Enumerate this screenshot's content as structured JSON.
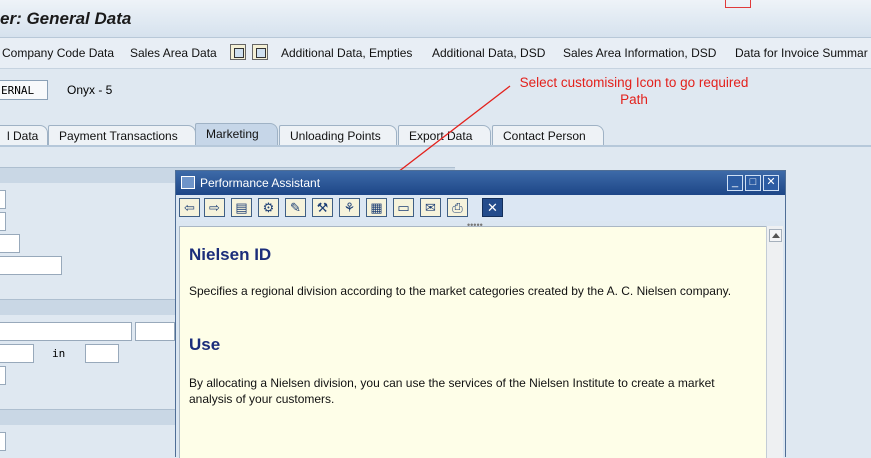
{
  "window": {
    "title": "er: General Data"
  },
  "toolbar": {
    "company_code": "Company Code Data",
    "sales_area": "Sales Area Data",
    "icon1": "document-icon",
    "icon2": "document-check-icon",
    "additional_empties": "Additional Data, Empties",
    "additional_dsd": "Additional Data, DSD",
    "sales_area_dsd": "Sales Area Information, DSD",
    "invoice_summary": "Data for Invoice Summar"
  },
  "header": {
    "code": "ERNAL",
    "name": "Onyx - 5"
  },
  "annotation": {
    "text": "Select customising Icon to go required Path",
    "color": "#e3211c"
  },
  "tabs": [
    {
      "label": "l Data",
      "active": false
    },
    {
      "label": "Payment Transactions",
      "active": false
    },
    {
      "label": "Marketing",
      "active": true
    },
    {
      "label": "Unloading Points",
      "active": false
    },
    {
      "label": "Export Data",
      "active": false
    },
    {
      "label": "Contact Person",
      "active": false
    }
  ],
  "form": {
    "in_label": "in"
  },
  "dialog": {
    "title": "Performance Assistant",
    "window_buttons": [
      "minimize-icon",
      "maximize-icon",
      "close-icon"
    ],
    "toolbar_buttons": [
      "back-arrow-icon",
      "forward-arrow-icon",
      "book-icon",
      "technical-info-icon",
      "edit-icon",
      "customizing-icon",
      "settings-icon",
      "table-icon",
      "personalize-icon",
      "notes-icon",
      "print-icon",
      "close-x-icon"
    ],
    "heading": "Nielsen ID",
    "body": "Specifies a regional division according to the market categories created by the A. C. Nielsen company.",
    "use_heading": "Use",
    "use_body": "By allocating a Nielsen division, you can use the services of the Nielsen Institute to create a market analysis of your customers."
  },
  "colors": {
    "accent": "#1d4687",
    "heading": "#1b2d7a",
    "help_bg": "#fefee8"
  }
}
